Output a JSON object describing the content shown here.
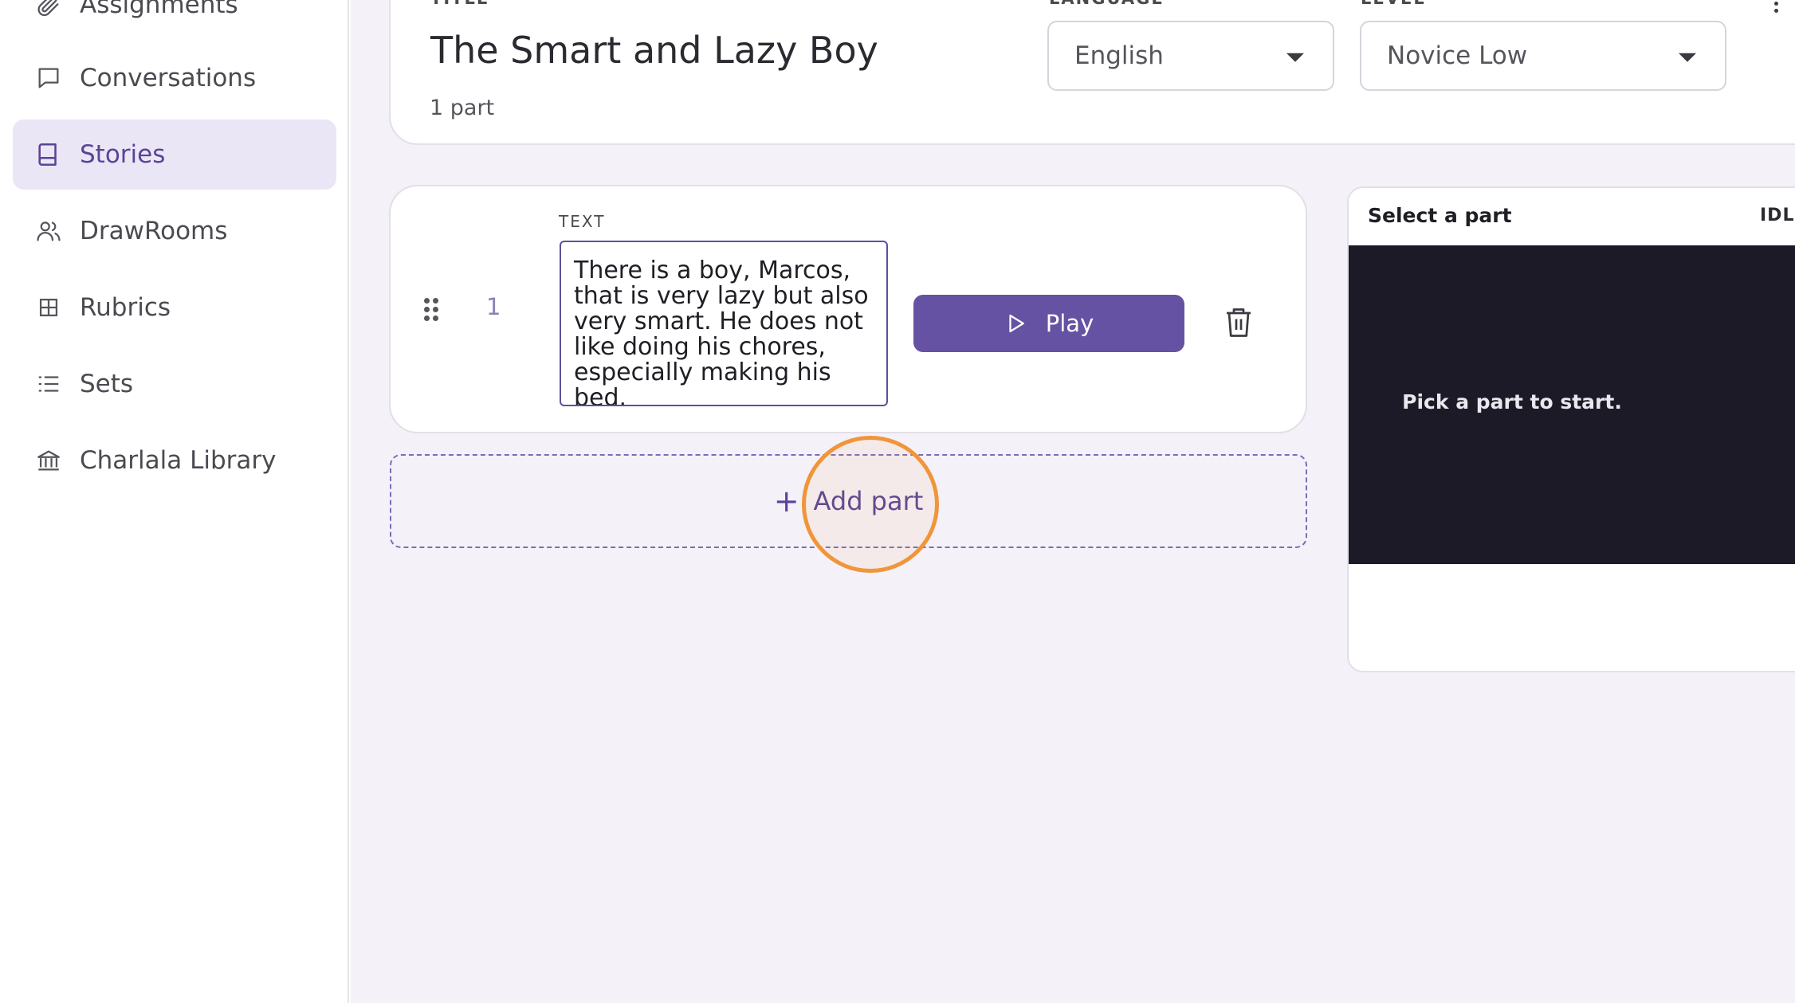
{
  "sidebar": {
    "items": [
      {
        "label": "Assignments",
        "icon": "paperclip-icon"
      },
      {
        "label": "Conversations",
        "icon": "chat-icon"
      },
      {
        "label": "Stories",
        "icon": "book-icon",
        "active": true
      },
      {
        "label": "DrawRooms",
        "icon": "users-icon"
      },
      {
        "label": "Rubrics",
        "icon": "grid-icon"
      },
      {
        "label": "Sets",
        "icon": "list-icon"
      },
      {
        "label": "Charlala Library",
        "icon": "library-icon"
      }
    ]
  },
  "header": {
    "title_label": "TITLE",
    "title": "The Smart and Lazy Boy",
    "parts_count": "1 part",
    "language_label": "LANGUAGE",
    "language": "English",
    "level_label": "LEVEL",
    "level": "Novice Low"
  },
  "parts": [
    {
      "number": "1",
      "text_label": "TEXT",
      "text": "There is a boy, Marcos, that is very lazy but also very smart. He does not like doing his chores, especially making his bed.",
      "play_label": "Play"
    }
  ],
  "add_part": {
    "plus": "+",
    "label": "Add part"
  },
  "preview": {
    "title": "Select a part",
    "status": "IDLE",
    "message": "Pick a part to start."
  },
  "colors": {
    "accent": "#6652a3",
    "active_bg": "#ebe6f5",
    "main_bg": "#f4f1f8",
    "preview_bg": "#1b1a26",
    "highlight_ring": "#f0953a"
  }
}
